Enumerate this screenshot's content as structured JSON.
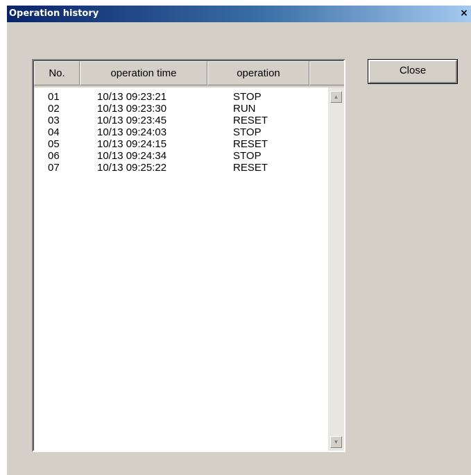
{
  "window": {
    "title": "Operation history",
    "close_glyph": "×"
  },
  "columns": [
    {
      "label": "No."
    },
    {
      "label": "operation time"
    },
    {
      "label": "operation"
    }
  ],
  "rows": [
    {
      "no": "01",
      "time": "10/13 09:23:21",
      "operation": "STOP"
    },
    {
      "no": "02",
      "time": "10/13 09:23:30",
      "operation": "RUN"
    },
    {
      "no": "03",
      "time": "10/13 09:23:45",
      "operation": "RESET"
    },
    {
      "no": "04",
      "time": "10/13 09:24:03",
      "operation": "STOP"
    },
    {
      "no": "05",
      "time": "10/13 09:24:15",
      "operation": "RESET"
    },
    {
      "no": "06",
      "time": "10/13 09:24:34",
      "operation": "STOP"
    },
    {
      "no": "07",
      "time": "10/13 09:25:22",
      "operation": "RESET"
    }
  ],
  "scrollbar": {
    "up_icon": "▲",
    "down_icon": "▼"
  },
  "buttons": {
    "close_label": "Close"
  }
}
